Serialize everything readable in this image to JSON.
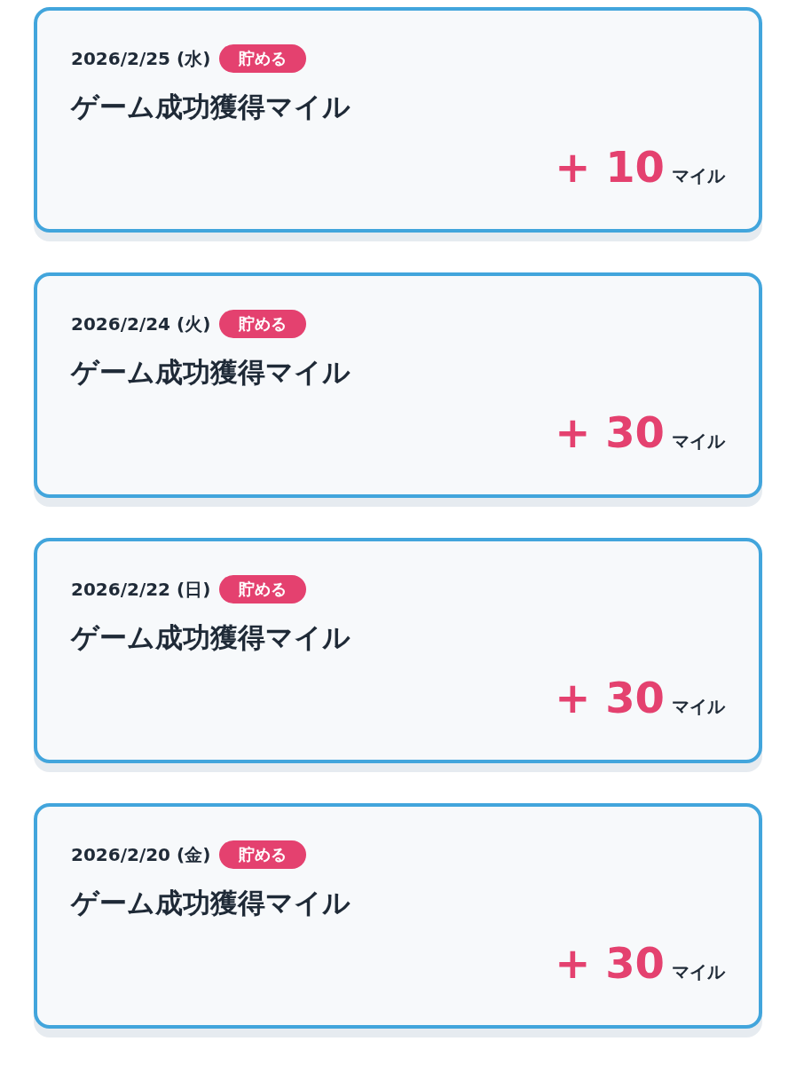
{
  "entries": [
    {
      "date": "2026/2/25 (水)",
      "badge": "貯める",
      "title": "ゲーム成功獲得マイル",
      "amount": "+ 10",
      "unit": "マイル"
    },
    {
      "date": "2026/2/24 (火)",
      "badge": "貯める",
      "title": "ゲーム成功獲得マイル",
      "amount": "+ 30",
      "unit": "マイル"
    },
    {
      "date": "2026/2/22 (日)",
      "badge": "貯める",
      "title": "ゲーム成功獲得マイル",
      "amount": "+ 30",
      "unit": "マイル"
    },
    {
      "date": "2026/2/20 (金)",
      "badge": "貯める",
      "title": "ゲーム成功獲得マイル",
      "amount": "+ 30",
      "unit": "マイル"
    }
  ]
}
